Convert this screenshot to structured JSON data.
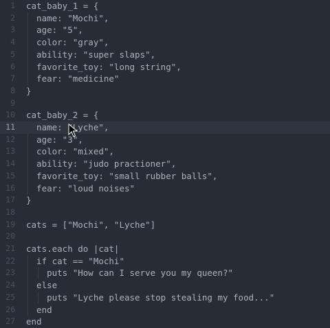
{
  "editor": {
    "lines": [
      {
        "num": "1",
        "text": "cat_baby_1 = {"
      },
      {
        "num": "2",
        "text": "  name: \"Mochi\","
      },
      {
        "num": "3",
        "text": "  age: \"5\","
      },
      {
        "num": "4",
        "text": "  color: \"gray\","
      },
      {
        "num": "5",
        "text": "  ability: \"super slaps\","
      },
      {
        "num": "6",
        "text": "  favorite_toy: \"long string\","
      },
      {
        "num": "7",
        "text": "  fear: \"medicine\""
      },
      {
        "num": "8",
        "text": "}"
      },
      {
        "num": "9",
        "text": ""
      },
      {
        "num": "10",
        "text": "cat_baby_2 = {"
      },
      {
        "num": "11",
        "text": "  name: \"Lyche\","
      },
      {
        "num": "12",
        "text": "  age: \"3\","
      },
      {
        "num": "13",
        "text": "  color: \"mixed\","
      },
      {
        "num": "14",
        "text": "  ability: \"judo practioner\","
      },
      {
        "num": "15",
        "text": "  favorite_toy: \"small rubber balls\","
      },
      {
        "num": "16",
        "text": "  fear: \"loud noises\""
      },
      {
        "num": "17",
        "text": "}"
      },
      {
        "num": "18",
        "text": ""
      },
      {
        "num": "19",
        "text": "cats = [\"Mochi\", \"Lyche\"]"
      },
      {
        "num": "20",
        "text": ""
      },
      {
        "num": "21",
        "text": "cats.each do |cat|"
      },
      {
        "num": "22",
        "text": "  if cat == \"Mochi\""
      },
      {
        "num": "23",
        "text": "    puts \"How can I serve you my queen?\""
      },
      {
        "num": "24",
        "text": "  else"
      },
      {
        "num": "25",
        "text": "    puts \"Lyche please stop stealing my food...\""
      },
      {
        "num": "26",
        "text": "  end"
      },
      {
        "num": "27",
        "text": "end"
      }
    ],
    "active_line": "11",
    "colors": {
      "background": "#282c34",
      "active_line_bg": "#2f343e",
      "text": "#abb2bf",
      "gutter": "#4b5263",
      "method_each": "#61afef"
    }
  }
}
